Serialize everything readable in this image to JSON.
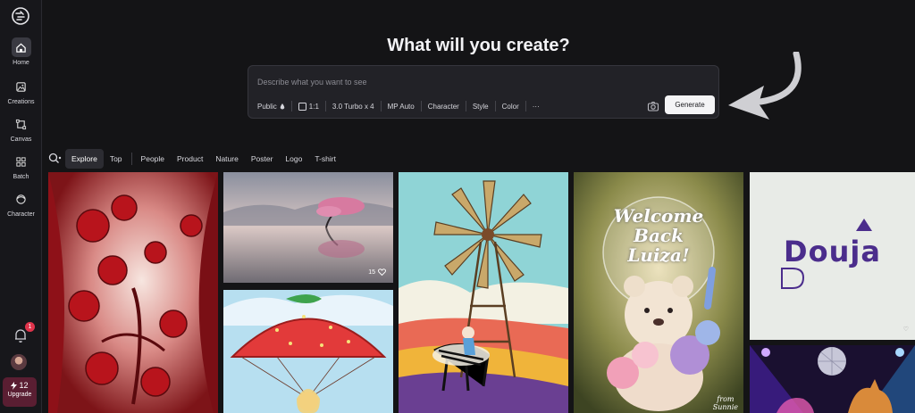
{
  "sidebar": {
    "items": [
      {
        "label": "Home",
        "icon": "home-icon"
      },
      {
        "label": "Creations",
        "icon": "image-icon"
      },
      {
        "label": "Canvas",
        "icon": "canvas-icon"
      },
      {
        "label": "Batch",
        "icon": "batch-icon"
      },
      {
        "label": "Character",
        "icon": "character-icon"
      }
    ],
    "notifications": "1",
    "upgrade": {
      "count": "12",
      "label": "Upgrade"
    }
  },
  "hero": {
    "title": "What will you create?"
  },
  "prompt": {
    "placeholder": "Describe what you want to see",
    "options": {
      "visibility": "Public",
      "ratio": "1:1",
      "model": "3.0 Turbo x 4",
      "mp": "MP Auto",
      "character": "Character",
      "style": "Style",
      "color": "Color",
      "more": "···"
    },
    "generate_label": "Generate"
  },
  "filters": [
    "Explore",
    "Top",
    "People",
    "Product",
    "Nature",
    "Poster",
    "Logo",
    "T-shirt"
  ],
  "gallery": {
    "tile2_likes": "15",
    "welcome_text": [
      "Welcome",
      "Back",
      "Luiza!"
    ],
    "from_text": [
      "from",
      "Sunnie"
    ],
    "douja_text": "Douja"
  },
  "colors": {
    "accent_upgrade": "#5a1e32",
    "badge": "#e0344c",
    "bg": "#141416"
  }
}
